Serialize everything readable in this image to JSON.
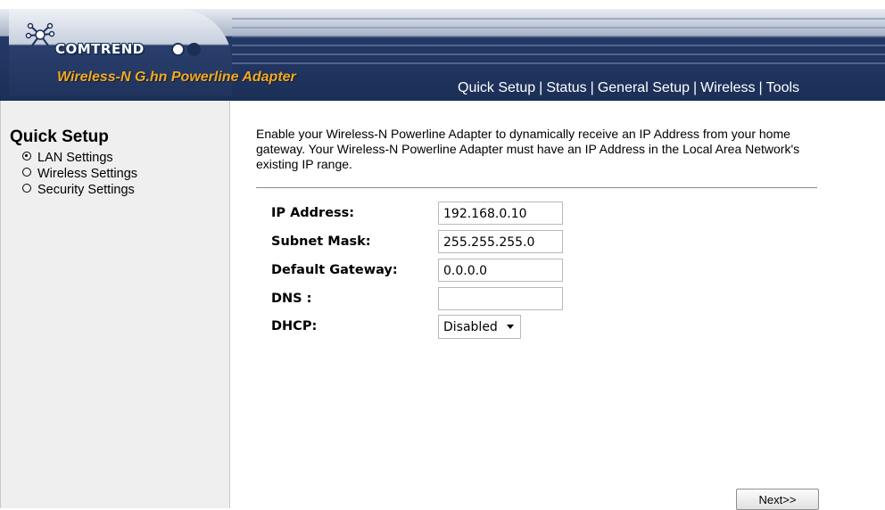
{
  "brand": {
    "logo_text": "COMTREND",
    "product_name": "Wireless-N G.hn Powerline Adapter"
  },
  "top_nav": {
    "items": [
      "Quick Setup",
      "Status",
      "General Setup",
      "Wireless",
      "Tools"
    ]
  },
  "sidebar": {
    "title": "Quick Setup",
    "items": [
      {
        "label": "LAN Settings",
        "selected": true
      },
      {
        "label": "Wireless Settings",
        "selected": false
      },
      {
        "label": "Security Settings",
        "selected": false
      }
    ]
  },
  "main": {
    "intro": "Enable your Wireless-N Powerline Adapter to dynamically receive an IP Address from your home gateway. Your Wireless-N Powerline Adapter must have an IP Address in the Local Area Network's existing IP range.",
    "fields": {
      "ip_label": "IP Address:",
      "ip_value": "192.168.0.10",
      "subnet_label": "Subnet Mask:",
      "subnet_value": "255.255.255.0",
      "gateway_label": "Default Gateway:",
      "gateway_value": "0.0.0.0",
      "dns_label": "DNS :",
      "dns_value": "",
      "dhcp_label": "DHCP:",
      "dhcp_value": "Disabled"
    },
    "next_button": "Next>>"
  },
  "colors": {
    "header_dark": "#1b2f57",
    "product_accent": "#f3a91e",
    "sidebar_bg": "#efefef"
  }
}
